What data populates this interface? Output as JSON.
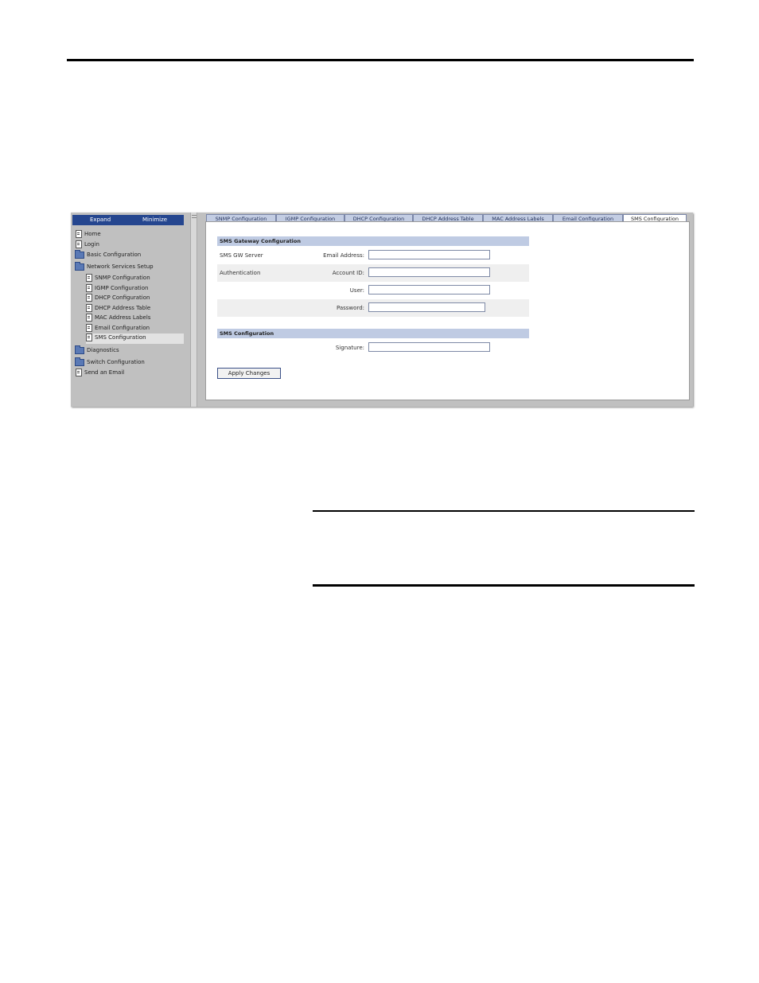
{
  "nav": {
    "expand_label": "Expand",
    "minimize_label": "Minimize",
    "items": [
      {
        "label": "Home",
        "icon": "document-icon"
      },
      {
        "label": "Login",
        "icon": "document-icon"
      },
      {
        "label": "Basic Configuration",
        "icon": "folder-icon"
      },
      {
        "label": "Network Services Setup",
        "icon": "folder-open-icon"
      },
      {
        "label": "SNMP Configuration",
        "icon": "document-icon"
      },
      {
        "label": "IGMP Configuration",
        "icon": "document-icon"
      },
      {
        "label": "DHCP Configuration",
        "icon": "document-icon"
      },
      {
        "label": "DHCP Address Table",
        "icon": "document-icon"
      },
      {
        "label": "MAC Address Labels",
        "icon": "document-icon"
      },
      {
        "label": "Email Configuration",
        "icon": "document-icon"
      },
      {
        "label": "SMS Configuration",
        "icon": "document-icon"
      },
      {
        "label": "Diagnostics",
        "icon": "folder-icon"
      },
      {
        "label": "Switch Configuration",
        "icon": "folder-icon"
      },
      {
        "label": "Send an Email",
        "icon": "document-icon"
      }
    ],
    "selected": "SMS Configuration"
  },
  "tabs": [
    {
      "label": "SNMP Configuration"
    },
    {
      "label": "IGMP Configuration"
    },
    {
      "label": "DHCP Configuration"
    },
    {
      "label": "DHCP Address Table"
    },
    {
      "label": "MAC Address Labels"
    },
    {
      "label": "Email Configuration"
    },
    {
      "label": "SMS Configuration"
    }
  ],
  "active_tab": "SMS Configuration",
  "gateway": {
    "heading": "SMS Gateway Configuration",
    "server_label": "SMS GW Server",
    "auth_label": "Authentication",
    "email_label": "Email Address:",
    "email_value": "",
    "account_label": "Account ID:",
    "account_value": "",
    "user_label": "User:",
    "user_value": "",
    "password_label": "Password:",
    "password_value": ""
  },
  "sms": {
    "heading": "SMS Configuration",
    "signature_label": "Signature:",
    "signature_value": ""
  },
  "apply_label": "Apply Changes",
  "colors": {
    "nav_header": "#25468f",
    "section_header": "#bfcbe3",
    "tab_inactive": "#c3cde3",
    "panel_bg": "#c0c0c0"
  }
}
